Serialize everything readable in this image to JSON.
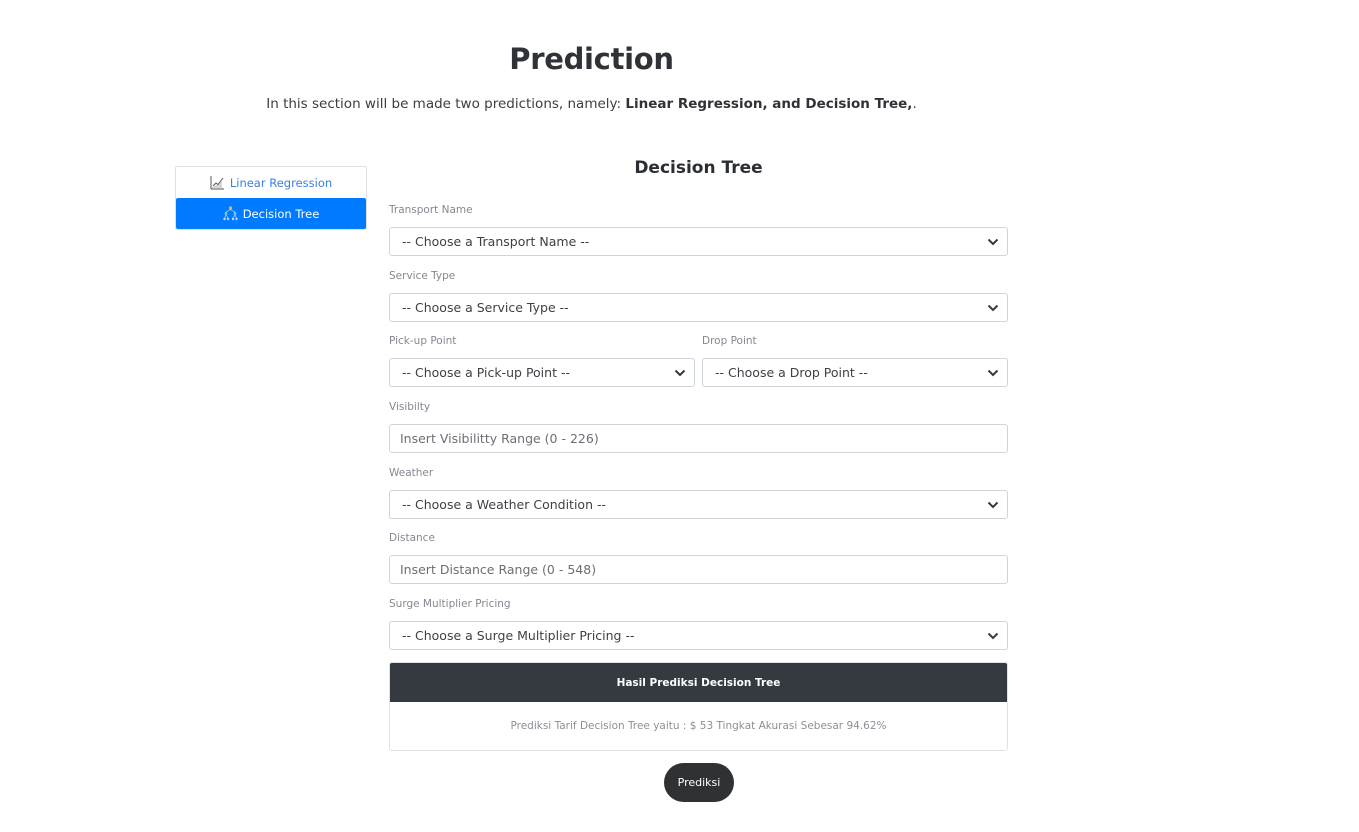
{
  "header": {
    "title": "Prediction",
    "intro_prefix": "In this section will be made two predictions, namely: ",
    "intro_bold": "Linear Regression, and Decision Tree,",
    "intro_suffix": "."
  },
  "tabs": [
    {
      "label": "Linear Regression",
      "icon": "line-chart-icon",
      "active": false
    },
    {
      "label": "Decision Tree",
      "icon": "decision-tree-icon",
      "active": true
    }
  ],
  "form": {
    "title": "Decision Tree",
    "transport_name": {
      "label": "Transport Name",
      "value": "-- Choose a Transport Name --"
    },
    "service_type": {
      "label": "Service Type",
      "value": "-- Choose a Service Type --"
    },
    "pickup_point": {
      "label": "Pick-up Point",
      "value": "-- Choose a Pick-up Point --"
    },
    "drop_point": {
      "label": "Drop Point",
      "value": "-- Choose a Drop Point --"
    },
    "visibility": {
      "label": "Visibilty",
      "placeholder": "Insert Visibilitty Range (0 - 226)"
    },
    "weather": {
      "label": "Weather",
      "value": "-- Choose a Weather Condition --"
    },
    "distance": {
      "label": "Distance",
      "placeholder": "Insert Distance Range (0 - 548)"
    },
    "surge": {
      "label": "Surge Multiplier Pricing",
      "value": "-- Choose a Surge Multiplier Pricing --"
    }
  },
  "result": {
    "title": "Hasil Prediksi Decision Tree",
    "text": "Prediksi Tarif Decision Tree yaitu : $ 53 Tingkat Akurasi Sebesar 94.62%"
  },
  "submit_label": "Prediksi",
  "colors": {
    "accent": "#007bff",
    "dark": "#343a40",
    "button": "#2f3133"
  }
}
